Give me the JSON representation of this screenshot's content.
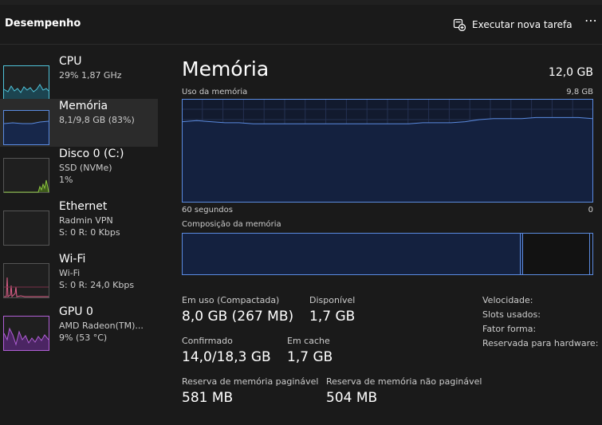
{
  "header": {
    "title": "Desempenho",
    "run_task_label": "Executar nova tarefa",
    "more_label": "⋯"
  },
  "sidebar": {
    "items": [
      {
        "name": "CPU",
        "lines": [
          "29%  1,87 GHz"
        ],
        "color": "#4fc3d9"
      },
      {
        "name": "Memória",
        "lines": [
          "8,1/9,8 GB (83%)"
        ],
        "color": "#5b8be0"
      },
      {
        "name": "Disco 0 (C:)",
        "lines": [
          "SSD (NVMe)",
          "1%"
        ],
        "color": "#8cc63f"
      },
      {
        "name": "Ethernet",
        "lines": [
          "Radmin VPN",
          "S: 0 R: 0 Kbps"
        ],
        "color": "#c77d3a"
      },
      {
        "name": "Wi-Fi",
        "lines": [
          "Wi-Fi",
          "S: 0 R: 24,0 Kbps"
        ],
        "color": "#e0608a"
      },
      {
        "name": "GPU 0",
        "lines": [
          "AMD Radeon(TM)...",
          "9%  (53 °C)"
        ],
        "color": "#b15fd6"
      }
    ]
  },
  "memory": {
    "title": "Memória",
    "total": "12,0 GB",
    "usage_label": "Uso da memória",
    "usage_max": "9,8 GB",
    "time_left": "60 segundos",
    "time_right": "0",
    "composition_label": "Composição da memória",
    "usage_series": [
      0.78,
      0.79,
      0.78,
      0.77,
      0.77,
      0.76,
      0.76,
      0.76,
      0.76,
      0.76,
      0.76,
      0.76,
      0.76,
      0.76,
      0.76,
      0.76,
      0.76,
      0.77,
      0.77,
      0.77,
      0.78,
      0.8,
      0.81,
      0.81,
      0.81,
      0.82,
      0.82,
      0.82,
      0.82,
      0.81
    ],
    "stats": {
      "in_use_label": "Em uso (Compactada)",
      "in_use_value": "8,0 GB (267 MB)",
      "available_label": "Disponível",
      "available_value": "1,7 GB",
      "committed_label": "Confirmado",
      "committed_value": "14,0/18,3 GB",
      "cached_label": "Em cache",
      "cached_value": "1,7 GB",
      "paged_label": "Reserva de memória paginável",
      "paged_value": "581 MB",
      "nonpaged_label": "Reserva de memória não paginável",
      "nonpaged_value": "504 MB"
    },
    "right_labels": {
      "speed": "Velocidade:",
      "slots": "Slots usados:",
      "form_factor": "Fator forma:",
      "reserved": "Reservada para hardware:"
    }
  },
  "colors": {
    "accent": "#5b8be0",
    "graph_fill": "#14213f",
    "grid": "#243152",
    "background": "#1a1a1a"
  }
}
